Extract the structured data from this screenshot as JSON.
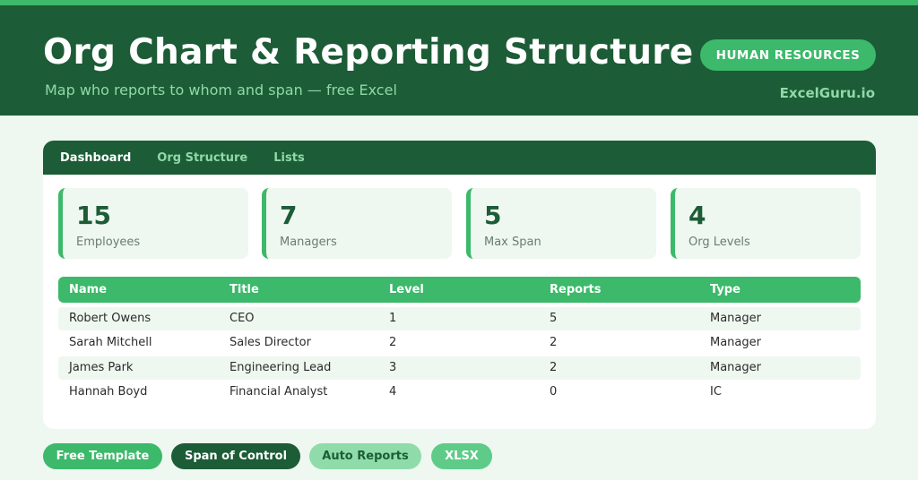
{
  "header": {
    "title": "Org Chart & Reporting Structure",
    "subtitle": "Map who reports to whom and span — free Excel",
    "badge": "HUMAN RESOURCES",
    "brand": "ExcelGuru.io"
  },
  "tabs": [
    {
      "label": "Dashboard",
      "active": true
    },
    {
      "label": "Org Structure",
      "active": false
    },
    {
      "label": "Lists",
      "active": false
    }
  ],
  "stats": [
    {
      "value": "15",
      "label": "Employees"
    },
    {
      "value": "7",
      "label": "Managers"
    },
    {
      "value": "5",
      "label": "Max Span"
    },
    {
      "value": "4",
      "label": "Org Levels"
    }
  ],
  "table": {
    "columns": [
      "Name",
      "Title",
      "Level",
      "Reports",
      "Type"
    ],
    "rows": [
      [
        "Robert Owens",
        "CEO",
        "1",
        "5",
        "Manager"
      ],
      [
        "Sarah Mitchell",
        "Sales Director",
        "2",
        "2",
        "Manager"
      ],
      [
        "James Park",
        "Engineering Lead",
        "3",
        "2",
        "Manager"
      ],
      [
        "Hannah Boyd",
        "Financial Analyst",
        "4",
        "0",
        "IC"
      ]
    ]
  },
  "tags": [
    {
      "label": "Free Template",
      "bg": "#3cb96a",
      "fg": "#ffffff"
    },
    {
      "label": "Span of Control",
      "bg": "#1c5c36",
      "fg": "#ffffff"
    },
    {
      "label": "Auto Reports",
      "bg": "#8fdcaa",
      "fg": "#1c5c36"
    },
    {
      "label": "XLSX",
      "bg": "#5fcb88",
      "fg": "#ffffff"
    }
  ],
  "colors": {
    "dark_green": "#1c5c36",
    "accent_green": "#3cb96a",
    "light_bg": "#eef7f0"
  }
}
